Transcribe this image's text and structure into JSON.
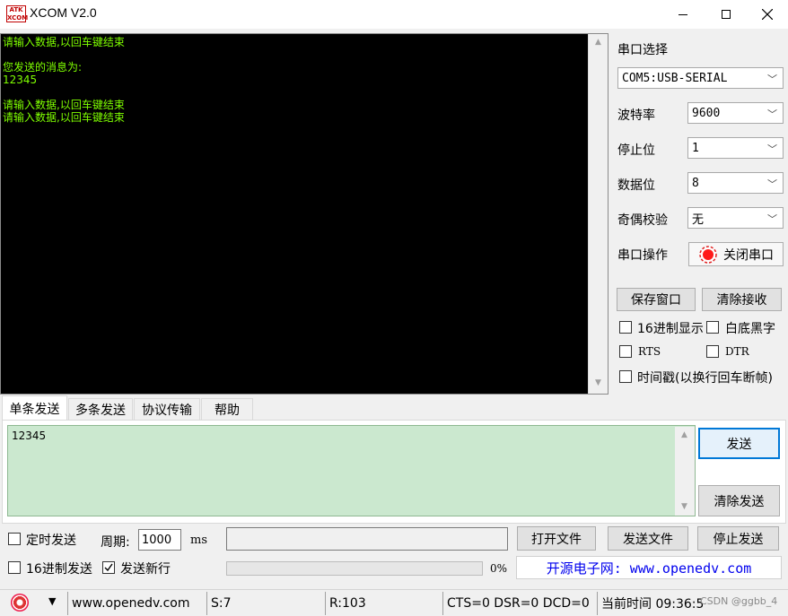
{
  "window": {
    "title": "XCOM V2.0",
    "logo_text_top": "ATK",
    "logo_text_bottom": "XCOM"
  },
  "receive": {
    "text": "请输入数据,以回车键结束\n\n您发送的消息为:\n12345\n\n请输入数据,以回车键结束\n请输入数据,以回车键结束",
    "text_color": "#7fff00",
    "background": "#000000"
  },
  "serial": {
    "port_select_label": "串口选择",
    "port_value": "COM5:USB-SERIAL",
    "baud_label": "波特率",
    "baud_value": "9600",
    "stop_label": "停止位",
    "stop_value": "1",
    "data_label": "数据位",
    "data_value": "8",
    "parity_label": "奇偶校验",
    "parity_value": "无",
    "operate_label": "串口操作",
    "close_port_button": "关闭串口",
    "save_window_button": "保存窗口",
    "clear_receive_button": "清除接收"
  },
  "options": {
    "hex_display": "16进制显示",
    "white_bg_black_text": "白底黑字",
    "rts": "RTS",
    "dtr": "DTR",
    "timestamp": "时间戳(以换行回车断帧)"
  },
  "tabs": [
    "单条发送",
    "多条发送",
    "协议传输",
    "帮助"
  ],
  "send": {
    "text": "12345",
    "send_button": "发送",
    "clear_send_button": "清除发送",
    "timed_send_label": "定时发送",
    "period_label": "周期:",
    "period_value": "1000",
    "period_unit": "ms",
    "hex_send_label": "16进制发送",
    "send_newline_label": "发送新行",
    "send_newline_checked": true,
    "open_file_button": "打开文件",
    "send_file_button": "发送文件",
    "stop_send_button": "停止发送",
    "progress_label": "0%",
    "progress_fraction": 0,
    "website_text": "开源电子网: www.openedv.com"
  },
  "status": {
    "website": "www.openedv.com",
    "sent": "S:7",
    "received": "R:103",
    "lines": "CTS=0 DSR=0 DCD=0",
    "time": "当前时间 09:36:53",
    "watermark": "CSDN @ggbb_4"
  }
}
